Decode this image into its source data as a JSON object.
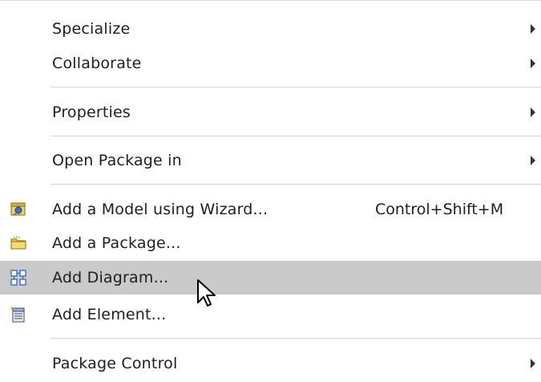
{
  "menu": {
    "items": [
      {
        "label": "Specialize",
        "submenu": true
      },
      {
        "label": "Collaborate",
        "submenu": true
      },
      {
        "label": "Properties",
        "submenu": true
      },
      {
        "label": "Open Package in",
        "submenu": true
      },
      {
        "label": "Add a Model using Wizard...",
        "shortcut": "Control+Shift+M",
        "icon": "model-wizard-icon"
      },
      {
        "label": "Add a Package...",
        "icon": "package-folder-icon"
      },
      {
        "label": "Add Diagram...",
        "icon": "diagram-icon",
        "highlighted": true
      },
      {
        "label": "Add Element...",
        "icon": "element-icon"
      },
      {
        "label": "Package Control",
        "submenu": true
      }
    ]
  },
  "colors": {
    "highlight": "#cacaca",
    "separator": "#d4d4d4",
    "icon_blue": "#2f63c8",
    "icon_yellow": "#f2cc3a"
  },
  "cursor": {
    "icon": "mouse-pointer-icon"
  }
}
